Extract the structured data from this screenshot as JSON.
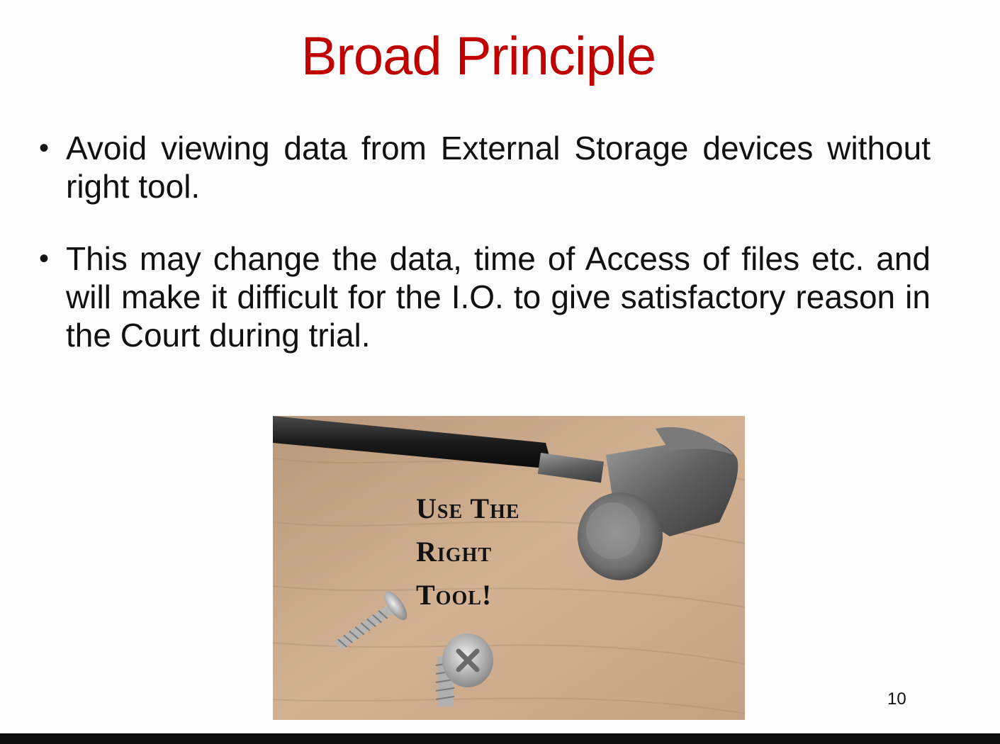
{
  "slide": {
    "title": "Broad Principle",
    "bullets": [
      "Avoid viewing data from External Storage devices without right tool.",
      "This may change the data, time of Access of files etc. and will make it difficult for the I.O. to give satisfactory reason in the Court during trial."
    ],
    "bullet_symbol": "•",
    "image": {
      "caption_lines": [
        "Use The",
        "Right",
        "Tool!"
      ],
      "depicts": [
        "hammer-icon",
        "screw-icon"
      ]
    },
    "page_number": "10"
  },
  "colors": {
    "title": "#c00000",
    "text": "#111111",
    "bottom_bar": "#0c0c0c"
  }
}
